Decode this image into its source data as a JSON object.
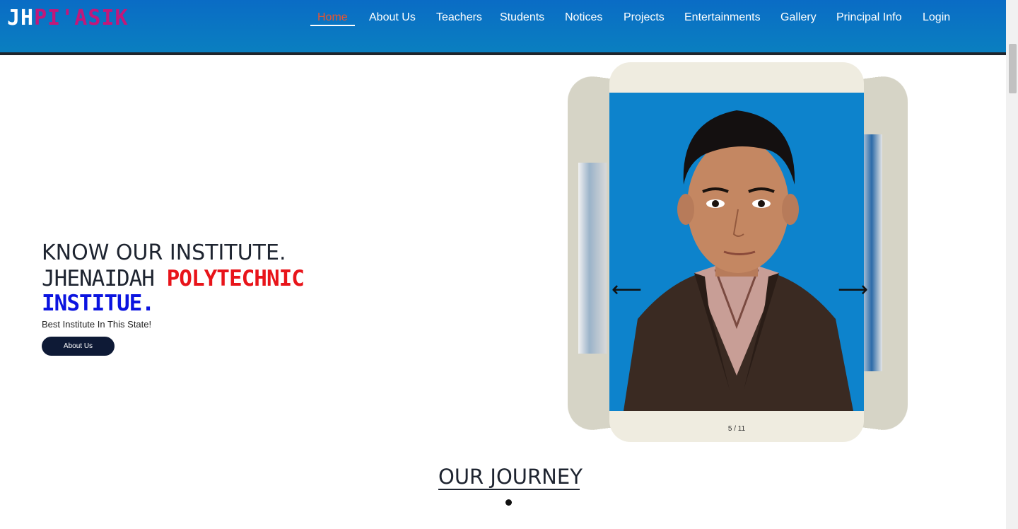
{
  "header": {
    "logo_part1": "JH",
    "logo_part2": "PI'ASIK",
    "nav": [
      {
        "label": "Home",
        "active": true
      },
      {
        "label": "About Us"
      },
      {
        "label": "Teachers"
      },
      {
        "label": "Students"
      },
      {
        "label": "Notices"
      },
      {
        "label": "Projects"
      },
      {
        "label": "Entertainments"
      },
      {
        "label": "Gallery"
      },
      {
        "label": "Principal Info"
      },
      {
        "label": "Login"
      }
    ]
  },
  "hero": {
    "line1": "KNOW OUR INSTITUTE.",
    "line2_part1": "JHENAIDAH ",
    "line2_part2": "POLYTECHNIC",
    "line3": "INSTITUE.",
    "subtitle": "Best Institute In This State!",
    "button_label": "About Us"
  },
  "carousel": {
    "counter": "5 / 11",
    "prev_icon": "arrow-left-icon",
    "next_icon": "arrow-right-icon"
  },
  "journey": {
    "title": "OUR JOURNEY"
  },
  "colors": {
    "header": "#0a7fc0",
    "active_nav": "#e8542f",
    "logo_accent": "#c2187a",
    "highlight_red": "#e8141a",
    "highlight_blue": "#0b14e0",
    "button": "#0e1a36"
  }
}
